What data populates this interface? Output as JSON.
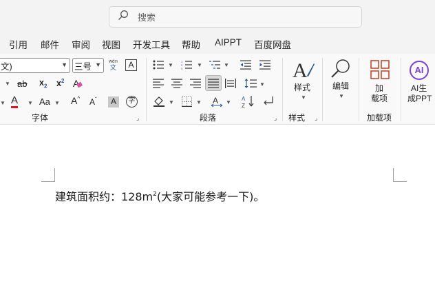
{
  "search": {
    "placeholder": "搜索",
    "icon": "search-icon"
  },
  "menu": {
    "items": [
      "引用",
      "邮件",
      "审阅",
      "视图",
      "开发工具",
      "帮助",
      "AIPPT",
      "百度网盘"
    ]
  },
  "font_group": {
    "font_name": "文)",
    "font_size": "三号",
    "phonetic_top": "wén",
    "phonetic_bottom": "文",
    "border_char": "A",
    "strike": "ab",
    "sub_x": "x",
    "sub_2": "2",
    "sup_x": "x",
    "sup_2": "2",
    "clear": "A",
    "font_color": "A",
    "font_color_hex": "#e81123",
    "case": "Aa",
    "grow": "A",
    "shrink": "A",
    "shading": "A",
    "enclose": "字",
    "label": "字体"
  },
  "paragraph_group": {
    "label": "段落"
  },
  "styles_group": {
    "button": "样式",
    "label": "样式"
  },
  "editing": {
    "button": "编辑"
  },
  "addins_group": {
    "button_line1": "加",
    "button_line2": "载项",
    "label": "加载项"
  },
  "ai_ppt": {
    "logo_text": "AI",
    "line1": "AI生",
    "line2": "成PPT",
    "accent": "#7b3fe4"
  },
  "accent_orange": "#c43e1c",
  "document": {
    "main": "建筑面积约：128m",
    "superscript": "2",
    "tail": "(大家可能参考一下)。"
  }
}
